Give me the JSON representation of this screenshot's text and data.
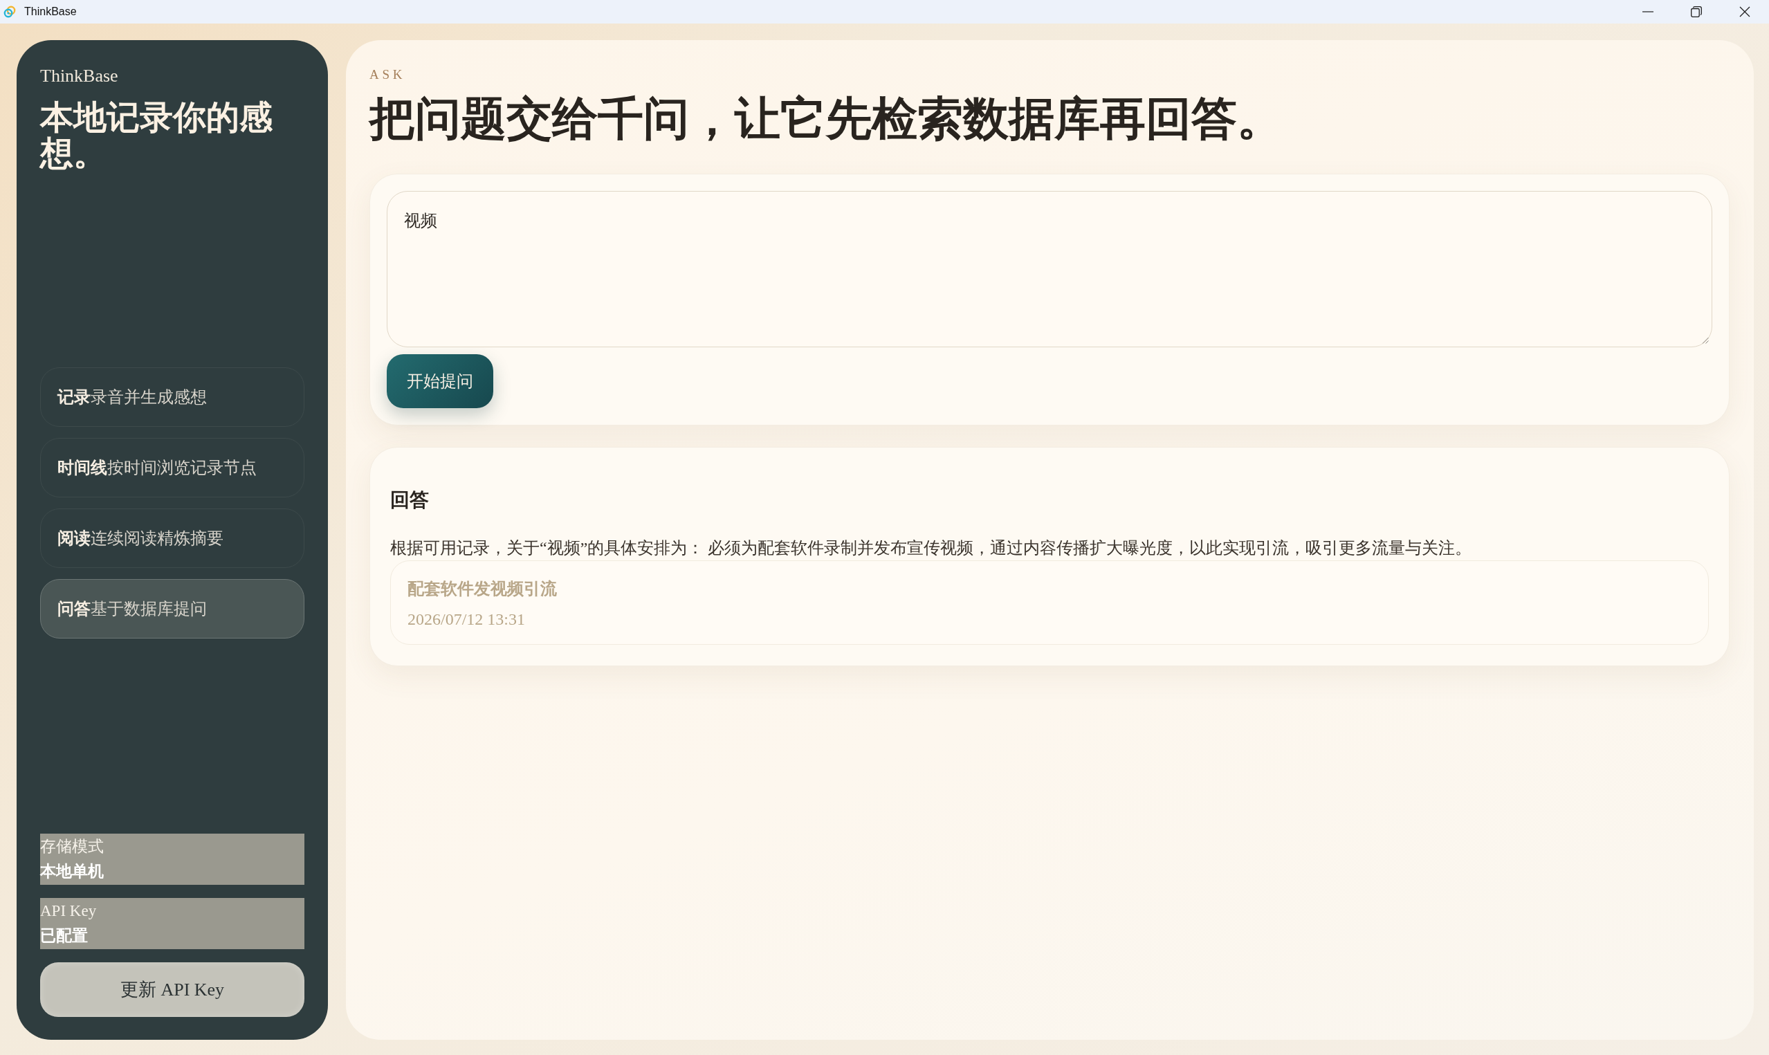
{
  "window": {
    "title": "ThinkBase"
  },
  "sidebar": {
    "brand": "ThinkBase",
    "headline": "本地记录你的感想。",
    "nav_items": [
      {
        "title": "记录",
        "description": "录音并生成感想",
        "selected": false
      },
      {
        "title": "时间线",
        "description": "按时间浏览记录节点",
        "selected": false
      },
      {
        "title": "阅读",
        "description": "连续阅读精炼摘要",
        "selected": false
      },
      {
        "title": "问答",
        "description": "基于数据库提问",
        "selected": true
      }
    ],
    "status": [
      {
        "label": "存储模式",
        "value": "本地单机"
      },
      {
        "label": "API Key",
        "value": "已配置"
      }
    ],
    "update_button": "更新 API Key"
  },
  "main": {
    "eyebrow": "ASK",
    "heading": "把问题交给千问，让它先检索数据库再回答。",
    "question": {
      "value": "视频"
    },
    "submit_button": "开始提问",
    "answer": {
      "title": "回答",
      "text": "根据可用记录，关于“视频”的具体安排为： 必须为配套软件录制并发布宣传视频，通过内容传播扩大曝光度，以此实现引流，吸引更多流量与关注。",
      "sources": [
        {
          "title": "配套软件发视频引流",
          "time": "2026/07/12 13:31"
        }
      ]
    }
  }
}
